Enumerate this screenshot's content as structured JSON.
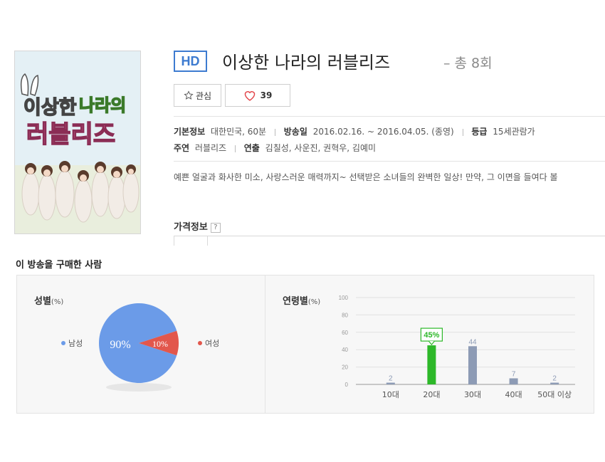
{
  "poster": {
    "title_line1a": "이상한",
    "title_line1b": "나라의",
    "title_line2": "러블리즈"
  },
  "header": {
    "badge": "HD",
    "title": "이상한 나라의 러블리즈",
    "episodes": "– 총 8회"
  },
  "buttons": {
    "favorite": "관심",
    "like_count": "39"
  },
  "info": {
    "basic_label": "기본정보",
    "basic_value": "대한민국, 60분",
    "air_label": "방송일",
    "air_value": "2016.02.16. ~ 2016.04.05. (종영)",
    "rating_label": "등급",
    "rating_value": "15세관람가",
    "cast_label": "주연",
    "cast_value": "러블리즈",
    "director_label": "연출",
    "director_value": "김칠성, 사운진, 권혁우, 김예미"
  },
  "description": "예쁜 얼굴과 화사한 미소, 사랑스러운 매력까지~ 선택받은 소녀들의 완벽한 일상! 만약, 그 이면을 들여다 볼",
  "price": {
    "title": "가격정보",
    "help": "?"
  },
  "buyers": {
    "title": "이 방송을 구매한 사람",
    "gender_title": "성별",
    "gender_unit": "(%)",
    "age_title": "연령별",
    "age_unit": "(%)",
    "legend_male": "남성",
    "legend_female": "여성"
  },
  "colors": {
    "accent_blue": "#3d7bd0",
    "male": "#6b9be8",
    "female": "#e2574c",
    "bar_default": "#8d9bb5",
    "bar_highlight": "#2db829"
  },
  "chart_data": [
    {
      "type": "pie",
      "categories": [
        "남성",
        "여성"
      ],
      "values": [
        90,
        10
      ],
      "labels": [
        "90%",
        "10%"
      ]
    },
    {
      "type": "bar",
      "categories": [
        "10대",
        "20대",
        "30대",
        "40대",
        "50대 이상"
      ],
      "values": [
        2,
        45,
        44,
        7,
        2
      ],
      "value_labels": [
        "2",
        "45%",
        "44",
        "7",
        "2"
      ],
      "highlight_index": 1,
      "ylim": [
        0,
        100
      ],
      "yticks": [
        0,
        20,
        40,
        60,
        80,
        100
      ],
      "grid": true
    }
  ]
}
